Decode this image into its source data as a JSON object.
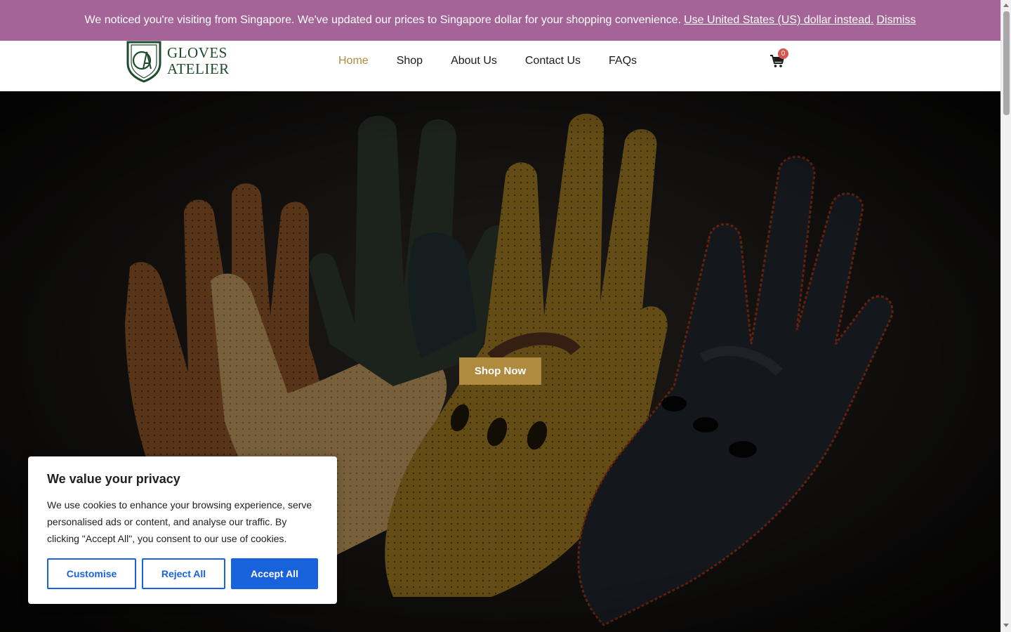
{
  "notice": {
    "message": "We noticed you're visiting from Singapore. We've updated our prices to Singapore dollar for your shopping convenience.",
    "switch_link": "Use United States (US) dollar instead.",
    "dismiss_link": "Dismiss",
    "background_color": "#a46497"
  },
  "header": {
    "logo_line1": "GLOVES",
    "logo_line2": "ATELIER",
    "logo_monogram": "AG",
    "nav": {
      "home": "Home",
      "shop": "Shop",
      "about": "About Us",
      "contact": "Contact Us",
      "faqs": "FAQs"
    },
    "active_nav": "Home",
    "cart_icon": "shopping-cart-icon",
    "cart_count": "0",
    "accent_color": "#b08a3e"
  },
  "hero": {
    "cta_label": "Shop Now",
    "image_subject": "driving-gloves"
  },
  "cookie_banner": {
    "title": "We value your privacy",
    "text": "We use cookies to enhance your browsing experience, serve personalised ads or content, and analyse our traffic. By clicking \"Accept All\", you consent to our use of cookies.",
    "customise_label": "Customise",
    "reject_label": "Reject All",
    "accept_label": "Accept All",
    "button_color": "#1863dc"
  }
}
